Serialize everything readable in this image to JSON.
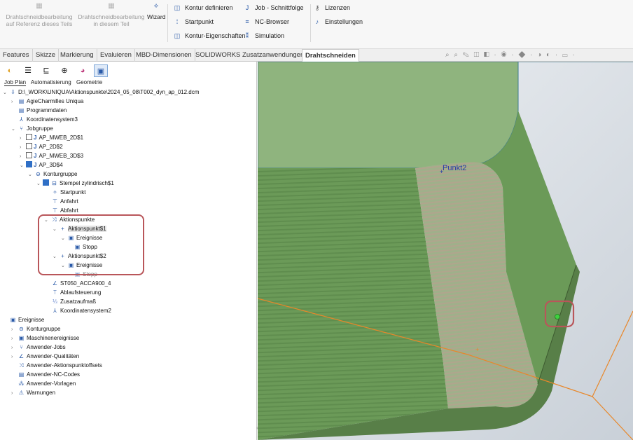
{
  "ribbon": {
    "big_buttons": [
      {
        "label": "Drahtschneidbearbeitung auf Referenz dieses Teils",
        "line1": "Drahtschneidbearbeitung",
        "line2": "auf Referenz dieses Teils",
        "icon": "part-reference-icon"
      },
      {
        "label": "Drahtschneidbearbeitung in diesem Teil",
        "line1": "Drahtschneidbearbeitung",
        "line2": "in diesem Teil",
        "icon": "part-local-icon"
      },
      {
        "label": "Wizard",
        "icon": "wizard-icon"
      }
    ],
    "col1": [
      "Kontur definieren",
      "Startpunkt",
      "Kontur-Eigenschaften"
    ],
    "col2": [
      "Job - Schnittfolge",
      "NC-Browser",
      "Simulation"
    ],
    "col3": [
      "Lizenzen",
      "Einstellungen"
    ]
  },
  "tabs": [
    "Features",
    "Skizze",
    "Markierung",
    "Evaluieren",
    "MBD-Dimensionen",
    "SOLIDWORKS Zusatzanwendungen",
    "Drahtschneiden"
  ],
  "active_tab": "Drahtschneiden",
  "subtabs": [
    "Job Plan",
    "Automatisierung",
    "Geometrie"
  ],
  "tree": {
    "root": "D:\\_WORK\\UNIQUA\\Aktionspunkte\\2024_05_08\\T002_dyn_ap_012.dcm",
    "machine": "AgieCharmilles Uniqua",
    "programmdaten": "Programmdaten",
    "koordinatensystem3": "Koordinatensystem3",
    "jobgruppe": "Jobgruppe",
    "jobs": [
      "AP_MWEB_2D$1",
      "AP_2D$2",
      "AP_MWEB_3D$3",
      "AP_3D$4"
    ],
    "konturgruppe": "Konturgruppe",
    "stempel": "Stempel zylindrisch$1",
    "startpunkt": "Startpunkt",
    "anfahrt": "Anfahrt",
    "abfahrt": "Abfahrt",
    "aktionspunkte": "Aktionspunkte",
    "ap1": "Aktionspunkt$1",
    "ereignisse": "Ereignisse",
    "stopp": "Stopp",
    "ap2": "Aktionspunkt$2",
    "st050": "ST050_ACCA900_4",
    "ablaufsteuerung": "Ablaufsteuerung",
    "zusatzaufmass": "Zusatzaufmaß",
    "koordinatensystem2": "Koordinatensystem2",
    "top_level": [
      "Ereignisse",
      "Konturgruppe",
      "Maschinenereignisse",
      "Anwender-Jobs",
      "Anwender-Qualitäten",
      "Anwender-Aktionspunktoffsets",
      "Anwender-NC-Codes",
      "Anwender-Vorlagen",
      "Warnungen"
    ]
  },
  "viewport": {
    "point_label": "Punkt2",
    "colors": {
      "part_face": "#6b9a58",
      "part_face_light": "#8fb47e",
      "background": "#dfe4ea",
      "wire_path": "#e8872a",
      "highlight": "#b9565a",
      "point": "#3fd13f"
    }
  }
}
